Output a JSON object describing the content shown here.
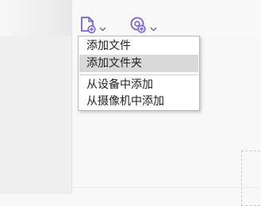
{
  "toolbar": {
    "add_file_icon": "file-plus-icon",
    "add_media_icon": "camera-plus-icon",
    "accent_color": "#7b5cf0"
  },
  "menu": {
    "items": [
      {
        "label": "添加文件"
      },
      {
        "label": "添加文件夹",
        "highlighted": true
      },
      {
        "label": "从设备中添加"
      },
      {
        "label": "从摄像机中添加"
      }
    ]
  }
}
